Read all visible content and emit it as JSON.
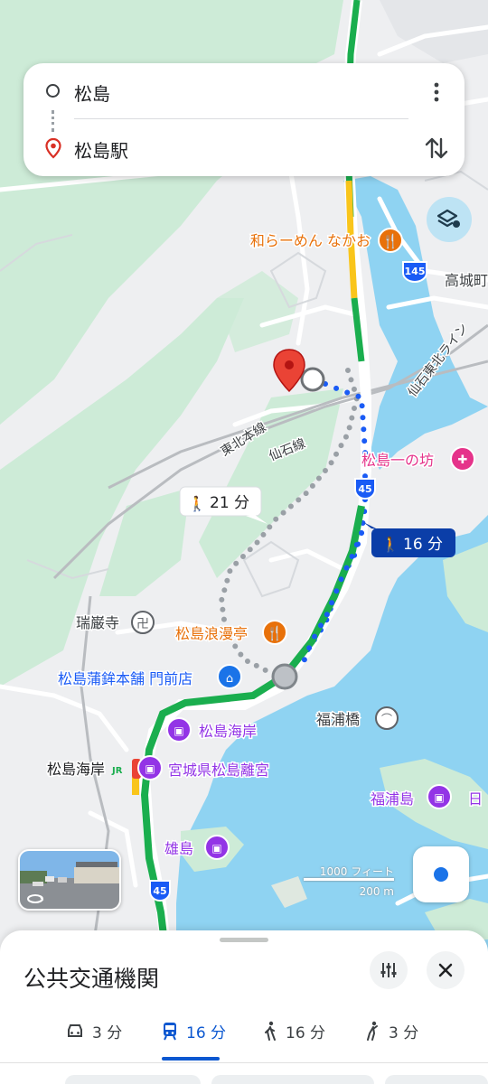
{
  "search": {
    "origin": "松島",
    "destination": "松島駅"
  },
  "map": {
    "labels": {
      "ramen": "和らーめん なかお",
      "takagi": "高城町",
      "route_badge_1": "145",
      "route_badge_2": "45",
      "route_badge_3": "45",
      "senseki_tohoku": "仙石東北ライン",
      "tohoku_line": "東北本線",
      "senseki_line": "仙石線",
      "ichinobo": "松島一の坊",
      "walk_time_label": "21 分",
      "transit_time_label": "16 分",
      "zuiganji": "瑞巌寺",
      "romantei": "松島浪漫亭",
      "kamaboko": "松島蒲鉾本舗 門前店",
      "fukuurabashi": "福浦橋",
      "kaigan_poi": "松島海岸",
      "kaigan_station": "松島海岸",
      "jr_mark": "JR",
      "rikyu": "宮城県松島離宮",
      "fukuurajima": "福浦島",
      "edge_text": "日",
      "ojima": "雄島",
      "scale_imperial": "1000 フィート",
      "scale_metric": "200 m"
    },
    "colors": {
      "land": "#eeeff1",
      "green": "#cdebd7",
      "water": "#8fd3f2",
      "route_green": "#1aae4e",
      "route_blue": "#1a5bf5",
      "walk_grey": "#9aa0a6",
      "poi_orange": "#e8710a",
      "poi_purple": "#9334e6",
      "poi_pink": "#e5338a"
    }
  },
  "sheet": {
    "title": "公共交通機関",
    "tabs": [
      {
        "icon": "car-icon",
        "label": "3 分"
      },
      {
        "icon": "train-icon",
        "label": "16 分"
      },
      {
        "icon": "walk-icon",
        "label": "16 分"
      },
      {
        "icon": "ride-icon",
        "label": "3 分"
      }
    ]
  }
}
